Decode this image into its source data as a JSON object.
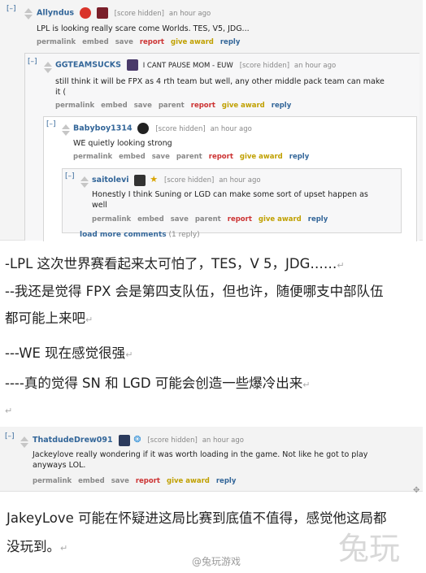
{
  "thread": {
    "c1": {
      "toggle": "[–]",
      "user": "Allyndus",
      "score_text": "[score hidden]",
      "time": "an hour ago",
      "body": "LPL is looking really scare come Worlds. TES, V5, JDG...",
      "buttons": [
        "permalink",
        "embed",
        "save",
        "report",
        "give award",
        "reply"
      ]
    },
    "c2": {
      "toggle": "[–]",
      "user": "GGTEAMSUCKS",
      "flair_text": "I CANT PAUSE MOM - EUW",
      "score_text": "[score hidden]",
      "time": "an hour ago",
      "body_line1": "still think it will be FPX as 4 rth team but well, any other middle pack team can make",
      "body_line2": "it (",
      "buttons": [
        "permalink",
        "embed",
        "save",
        "parent",
        "report",
        "give award",
        "reply"
      ]
    },
    "c3": {
      "toggle": "[–]",
      "user": "Babyboy1314",
      "score_text": "[score hidden]",
      "time": "an hour ago",
      "body": "WE quietly looking strong",
      "buttons": [
        "permalink",
        "embed",
        "save",
        "parent",
        "report",
        "give award",
        "reply"
      ]
    },
    "c4": {
      "toggle": "[–]",
      "user": "saitolevi",
      "score_text": "[score hidden]",
      "time": "an hour ago",
      "body_line1": "Honestly I think Suning or LGD can make some sort of upset happen as",
      "body_line2": "well",
      "buttons": [
        "permalink",
        "embed",
        "save",
        "parent",
        "report",
        "give award",
        "reply"
      ]
    },
    "load_more": "load more comments",
    "load_more_count": "(1 reply)"
  },
  "translations": {
    "line1": "-LPL 这次世界赛看起来太可怕了，TES，V 5，JDG……",
    "line2": "--我还是觉得 FPX 会是第四支队伍，但也许，随便哪支中部队伍",
    "line3": "都可能上来吧",
    "line4": "---WE 现在感觉很强",
    "line5": "----真的觉得 SN 和 LGD 可能会创造一些爆冷出来",
    "line6": "JakeyLove 可能在怀疑进这局比赛到底值不值得，感觉他这局都",
    "line7": "没玩到。"
  },
  "thread2": {
    "c1": {
      "toggle": "[–]",
      "user": "ThatdudeDrew091",
      "score_text": "[score hidden]",
      "time": "an hour ago",
      "body_line1": "Jackeylove really wondering if it was worth loading in the game. Not like he got to play",
      "body_line2": "anyways LOL.",
      "buttons": [
        "permalink",
        "embed",
        "save",
        "report",
        "give award",
        "reply"
      ]
    }
  },
  "para_mark": "↵",
  "watermark_text": "@兔玩游戏",
  "logo_text": "兔玩"
}
